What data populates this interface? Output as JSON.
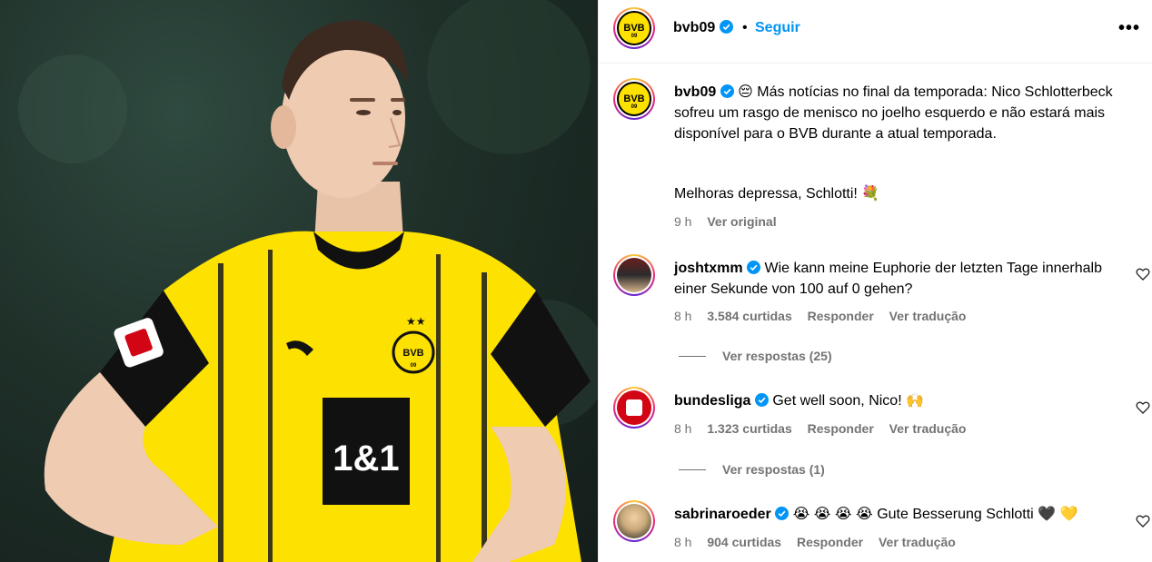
{
  "header": {
    "username": "bvb09",
    "separator": "•",
    "follow_label": "Seguir",
    "more_label": "•••"
  },
  "caption": {
    "username": "bvb09",
    "emoji": "😔",
    "text": "Más notícias no final da temporada: Nico Schlotterbeck sofreu um rasgo de menisco no joelho esquerdo e não estará mais disponível para o BVB durante a atual temporada.",
    "text2": "Melhoras depressa, Schlotti! 💐",
    "time": "9 h",
    "see_original": "Ver original"
  },
  "comments": [
    {
      "username": "joshtxmm",
      "text": "Wie kann meine Euphorie der letzten Tage innerhalb einer Sekunde von 100 auf 0 gehen?",
      "time": "8 h",
      "likes": "3.584 curtidas",
      "reply": "Responder",
      "translate": "Ver tradução",
      "view_replies": "Ver respostas (25)"
    },
    {
      "username": "bundesliga",
      "text": "Get well soon, Nico! 🙌",
      "time": "8 h",
      "likes": "1.323 curtidas",
      "reply": "Responder",
      "translate": "Ver tradução",
      "view_replies": "Ver respostas (1)"
    },
    {
      "username": "sabrinaroeder",
      "text": "😭 😭 😭 😭  Gute Besserung Schlotti 🖤 💛",
      "time": "8 h",
      "likes": "904 curtidas",
      "reply": "Responder",
      "translate": "Ver tradução"
    }
  ],
  "photo": {
    "sponsor_text": "1&1",
    "crest_text": "BVB",
    "crest_year": "09"
  },
  "colors": {
    "accent_blue": "#0095f6",
    "bvb_yellow": "#fde100",
    "muted_gray": "#737373"
  }
}
